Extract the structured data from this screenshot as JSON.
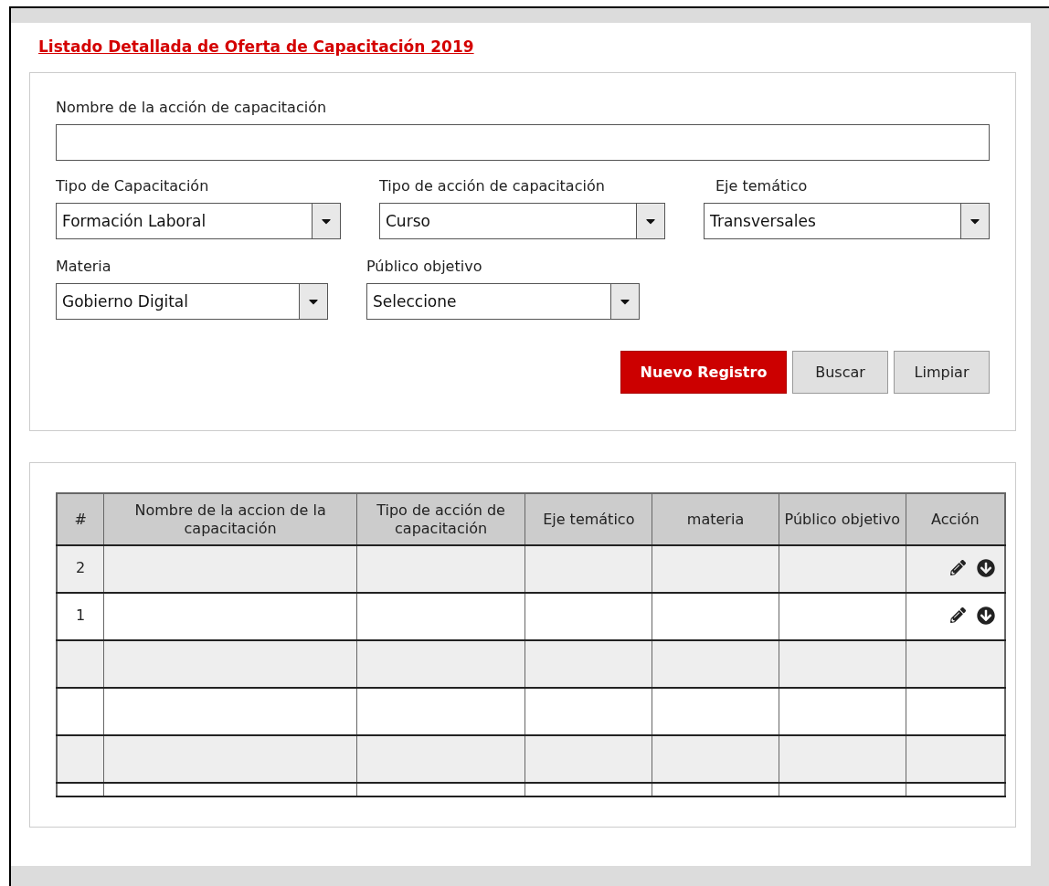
{
  "title": "Listado Detallada de Oferta de Capacitación 2019",
  "filters": {
    "name_field": {
      "label": "Nombre de la acción de capacitación"
    },
    "dropdown_rows": [
      {
        "dropdowns": [
          {
            "label": "Tipo de Capacitación",
            "value": "Formación Laboral"
          },
          {
            "label": "Tipo de acción de capacitación",
            "value": "Curso"
          },
          {
            "label": "Eje temático",
            "value": "Transversales"
          }
        ]
      },
      {
        "dropdowns": [
          {
            "label": "Materia",
            "value": "Gobierno Digital"
          },
          {
            "label": "Público objetivo",
            "value": "Seleccione"
          }
        ]
      }
    ],
    "buttons": [
      {
        "label": "Nuevo Registro",
        "kind": "primary"
      },
      {
        "label": "Buscar",
        "kind": "secondary"
      },
      {
        "label": "Limpiar",
        "kind": "secondary"
      }
    ]
  },
  "table": {
    "columns": [
      "#",
      "Nombre de la accion de la capacitación",
      "Tipo de acción de capacitación",
      "Eje temático",
      "materia",
      "Público objetivo",
      "Acción"
    ],
    "rows": [
      {
        "kind": "entry",
        "number": "2"
      },
      {
        "kind": "entry",
        "number": "1"
      },
      {
        "kind": "blank"
      },
      {
        "kind": "blank"
      },
      {
        "kind": "blank"
      },
      {
        "kind": "stub"
      }
    ]
  }
}
